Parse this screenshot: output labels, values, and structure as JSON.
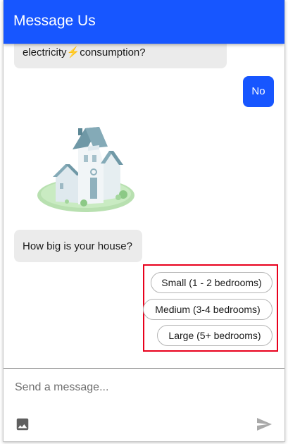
{
  "header": {
    "title": "Message Us"
  },
  "messages": {
    "previous_bot_text": "electricity",
    "previous_bot_icon": "lightning-bolt-emoji",
    "previous_bot_text_end": "consumption?",
    "user_reply": "No",
    "house_image": "house-illustration",
    "bot_question": "How big is your house?"
  },
  "quick_replies": [
    {
      "label": "Small (1 - 2 bedrooms)"
    },
    {
      "label": "Medium (3-4 bedrooms)"
    },
    {
      "label": "Large (5+ bedrooms)"
    }
  ],
  "composer": {
    "placeholder": "Send a message...",
    "image_icon": "image-icon",
    "send_icon": "send-icon"
  },
  "colors": {
    "primary": "#1756ff",
    "bot_bubble": "#ebebeb",
    "highlight_border": "#e8001c"
  }
}
